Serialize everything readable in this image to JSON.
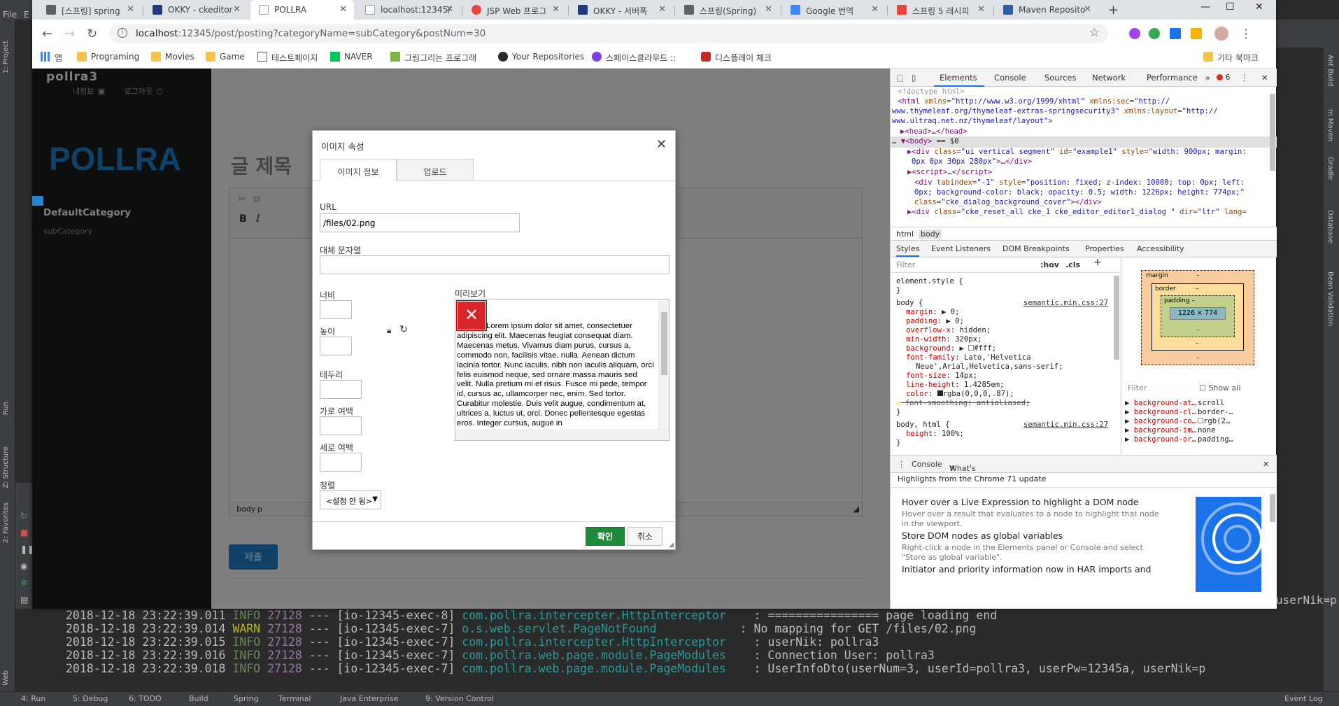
{
  "ide": {
    "menu": [
      "File",
      "E"
    ],
    "left_strip": [
      "1: Project",
      "Run",
      "Z: Structure",
      "2: Favorites",
      "Web"
    ],
    "right_strip": [
      "Ant Build",
      "m Maven",
      "Gradle",
      "Database",
      "Bean Validation"
    ],
    "console_lines": [
      {
        "ts": "2018-12-18 23:22:39.011",
        "level": "INFO",
        "pid": "27128",
        "sep": "---",
        "thread": "[io-12345-exec-8]",
        "cls": "com.pollra.intercepter.HttpInterceptor",
        "msg": ": ================ page loading end"
      },
      {
        "ts": "2018-12-18 23:22:39.014",
        "level": "WARN",
        "pid": "27128",
        "sep": "---",
        "thread": "[io-12345-exec-7]",
        "cls": "o.s.web.servlet.PageNotFound",
        "msg": ": No mapping for GET /files/02.png"
      },
      {
        "ts": "2018-12-18 23:22:39.015",
        "level": "INFO",
        "pid": "27128",
        "sep": "---",
        "thread": "[io-12345-exec-7]",
        "cls": "com.pollra.intercepter.HttpInterceptor",
        "msg": ": userNik: pollra3"
      },
      {
        "ts": "2018-12-18 23:22:39.016",
        "level": "INFO",
        "pid": "27128",
        "sep": "---",
        "thread": "[io-12345-exec-7]",
        "cls": "com.pollra.web.page.module.PageModules",
        "msg": ": Connection User: pollra3"
      },
      {
        "ts": "2018-12-18 23:22:39.018",
        "level": "INFO",
        "pid": "27128",
        "sep": "---",
        "thread": "[io-12345-exec-7]",
        "cls": "com.pollra.web.page.module.PageModules",
        "msg": ": UserInfoDto(userNum=3, userId=pollra3, userPw=12345a, userNik=p"
      }
    ],
    "right_fragment": "userNik=p",
    "statusbar": [
      "4: Run",
      "5: Debug",
      "6: TODO",
      "Build",
      "Spring",
      "Terminal",
      "Java Enterprise",
      "9: Version Control",
      "Event Log"
    ]
  },
  "browser": {
    "tabs": [
      {
        "label": "[스프링] spring",
        "color": "#5f6368"
      },
      {
        "label": "OKKY - ckeditor",
        "color": "#1f3b7a"
      },
      {
        "label": "POLLRA",
        "color": "#9aa0a6",
        "active": true
      },
      {
        "label": "localhost:12345/",
        "color": "#9aa0a6"
      },
      {
        "label": "JSP Web 프로그",
        "color": "#e8453c"
      },
      {
        "label": "OKKY - 서버폭",
        "color": "#1f3b7a"
      },
      {
        "label": "스프링(Spring)",
        "color": "#5f6368"
      },
      {
        "label": "Google 번역",
        "color": "#4285f4"
      },
      {
        "label": "스프링 5 레시피",
        "color": "#e8453c"
      },
      {
        "label": "Maven Reposito",
        "color": "#2d5fa6"
      }
    ],
    "url_host": "localhost",
    "url_rest": ":12345/post/posting?categoryName=subCategory&postNum=30",
    "bookmarks": [
      {
        "label": "앱",
        "kind": "apps"
      },
      {
        "label": "Programing",
        "kind": "folder"
      },
      {
        "label": "Movies",
        "kind": "folder"
      },
      {
        "label": "Game",
        "kind": "folder"
      },
      {
        "label": "테스트페이지",
        "kind": "page"
      },
      {
        "label": "NAVER",
        "kind": "naver"
      },
      {
        "label": "그림그리는 프로그래",
        "kind": "green"
      },
      {
        "label": "Your Repositories",
        "kind": "github"
      },
      {
        "label": "스페이스클라우드 ::",
        "kind": "space"
      },
      {
        "label": "디스플레이 체크",
        "kind": "car"
      }
    ],
    "other_bookmarks": "기타 북마크"
  },
  "site": {
    "user": "pollra3",
    "my_info": "내정보",
    "logout": "로그아웃",
    "brand": "POLLRA",
    "category": "DefaultCategory",
    "subcategory": "subCategory",
    "post_title_placeholder": "글 제목",
    "editor_path": [
      "body",
      "p"
    ],
    "submit": "제출"
  },
  "dialog": {
    "title": "이미지 속성",
    "tabs": [
      "이미지 정보",
      "업로드"
    ],
    "url_label": "URL",
    "url_value": "/files/02.png",
    "alt_label": "대체 문자열",
    "width_label": "너비",
    "height_label": "높이",
    "border_label": "테두리",
    "hspace_label": "가로 여백",
    "vspace_label": "세로 여백",
    "align_label": "정렬",
    "align_value": "<설정 안 됨>",
    "preview_label": "미리보기",
    "preview_text": "Lorem ipsum dolor sit amet, consectetuer adipiscing elit. Maecenas feugiat consequat diam. Maecenas metus. Vivamus diam purus, cursus a, commodo non, facilisis vitae, nulla. Aenean dictum lacinia tortor. Nunc iaculis, nibh non iaculis aliquam, orci felis euismod neque, sed ornare massa mauris sed velit. Nulla pretium mi et risus. Fusce mi pede, tempor id, cursus ac, ullamcorper nec, enim. Sed tortor. Curabitur molestie. Duis velit augue, condimentum at, ultrices a, luctus ut, orci. Donec pellentesque egestas eros. Integer cursus, augue in",
    "ok": "확인",
    "cancel": "취소"
  },
  "devtools": {
    "tabs": [
      "Elements",
      "Console",
      "Sources",
      "Network",
      "Performance"
    ],
    "more": "»",
    "error_count": "6",
    "crumbs": [
      "html",
      "body"
    ],
    "subtabs": [
      "Styles",
      "Event Listeners",
      "DOM Breakpoints",
      "Properties",
      "Accessibility"
    ],
    "filter_placeholder": "Filter",
    "hov": ":hov",
    "cls": ".cls",
    "box": {
      "margin": "margin",
      "border": "border",
      "padding": "padding –",
      "content": "1226 × 774",
      "dash": "–"
    },
    "computed_filter": "Filter",
    "show_all": "Show all",
    "computed": [
      {
        "p": "background-at…",
        "v": "scroll"
      },
      {
        "p": "background-cl…",
        "v": "border-…"
      },
      {
        "p": "background-co…",
        "v": "rgb(2…"
      },
      {
        "p": "background-im…",
        "v": "none"
      },
      {
        "p": "background-or…",
        "v": "padding…"
      }
    ],
    "drawer_tabs": [
      "Console",
      "What's New"
    ],
    "drawer_heading": "Highlights from the Chrome 71 update",
    "whats_new": [
      {
        "h": "Hover over a Live Expression to highlight a DOM node",
        "d": "Hover over a result that evaluates to a node to highlight that node in the viewport."
      },
      {
        "h": "Store DOM nodes as global variables",
        "d": "Right-click a node in the Elements panel or Console and select \"Store as global variable\"."
      },
      {
        "h": "Initiator and priority information now in HAR imports and",
        "d": ""
      }
    ]
  }
}
